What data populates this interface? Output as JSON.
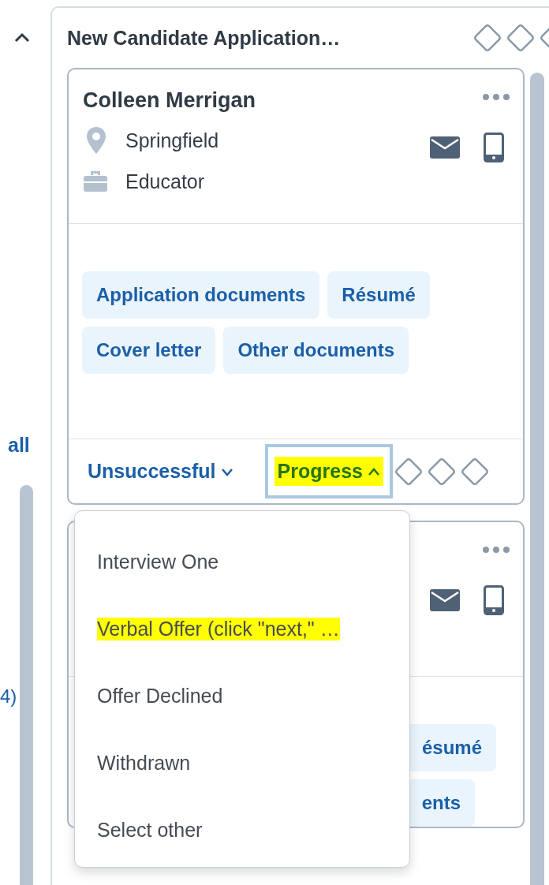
{
  "sidebar": {
    "link_text": "all",
    "text_fragment": "4)"
  },
  "column": {
    "title": "New Candidate Application…",
    "cards": [
      {
        "name": "Colleen Merrigan",
        "location": "Springfield",
        "role": "Educator",
        "tags": [
          "Application documents",
          "Résumé",
          "Cover letter",
          "Other documents"
        ],
        "footer": [
          {
            "label": "Unsuccessful",
            "expanded": false,
            "highlighted": false,
            "focused": false
          },
          {
            "label": "Progress",
            "expanded": true,
            "highlighted": true,
            "focused": true
          }
        ]
      },
      {
        "tags": [
          "ésumé",
          "ents"
        ]
      }
    ]
  },
  "menu": {
    "items": [
      {
        "label": "Interview One",
        "highlighted": false
      },
      {
        "label": "Verbal Offer (click \"next,\" …",
        "highlighted": true
      },
      {
        "label": "Offer Declined",
        "highlighted": false
      },
      {
        "label": "Withdrawn",
        "highlighted": false
      },
      {
        "label": "Select other",
        "highlighted": false
      }
    ]
  }
}
